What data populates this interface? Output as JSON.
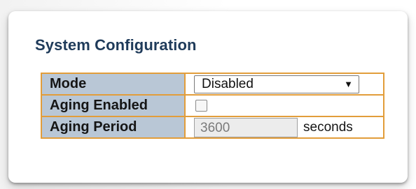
{
  "section_title": "System Configuration",
  "rows": [
    {
      "label": "Mode",
      "select_value": "Disabled",
      "select_icon": "dropdown-arrow-icon"
    },
    {
      "label": "Aging Enabled",
      "checked": false
    },
    {
      "label": "Aging Period",
      "value": "3600",
      "unit": "seconds"
    }
  ],
  "colors": {
    "label_bg": "#b9c7d6",
    "border": "#e29d3a",
    "title": "#1f3b5a"
  }
}
